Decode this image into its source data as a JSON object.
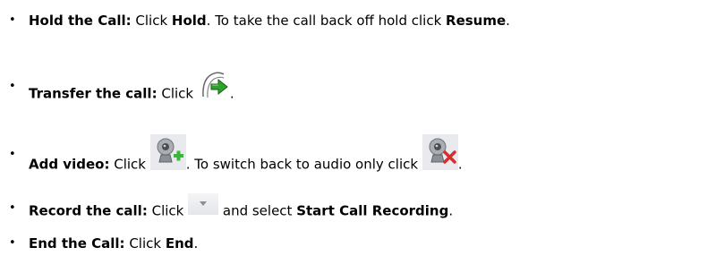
{
  "items": [
    {
      "label": "Hold the Call:",
      "p1": " Click ",
      "b1": "Hold",
      "p2": ". To take the call back off hold click ",
      "b2": "Resume",
      "p3": "."
    },
    {
      "label": "Transfer the call:",
      "p1": " Click ",
      "icon": "transfer-call-icon",
      "p2": "."
    },
    {
      "label": "Add video:",
      "p1": " Click ",
      "icon": "add-video-icon",
      "p2": ". To switch back to audio only click ",
      "icon2": "remove-video-icon",
      "p3": "."
    },
    {
      "label": "Record the call:",
      "p1": " Click ",
      "icon": "dropdown-arrow-icon",
      "p2": " and select ",
      "b1": "Start Call Recording",
      "p3": "."
    },
    {
      "label": "End the Call:",
      "p1": " Click ",
      "b1": "End",
      "p2": "."
    }
  ],
  "colors": {
    "transfer_arrow": "#2fa22b",
    "add_plus": "#3bb53b",
    "remove_x": "#e02a2a",
    "webcam_gray": "#8a9096"
  }
}
